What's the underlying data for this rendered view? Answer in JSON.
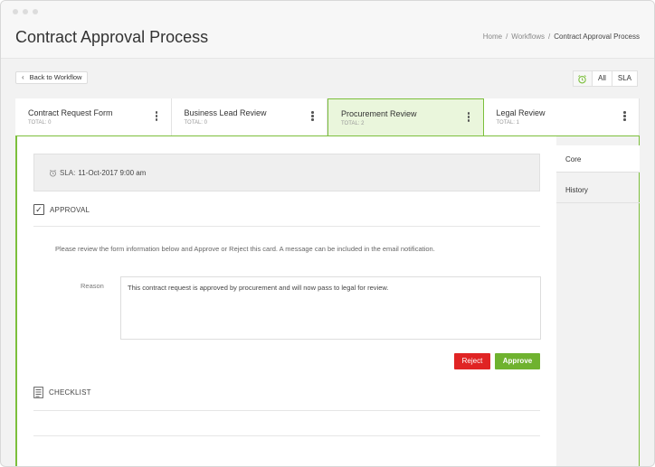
{
  "page": {
    "title": "Contract Approval Process",
    "breadcrumb": [
      "Home",
      "Workflows",
      "Contract Approval Process"
    ]
  },
  "toolbar": {
    "back_label": "Back to Workflow",
    "filter_all": "All",
    "filter_sla": "SLA"
  },
  "stages": [
    {
      "name": "Contract Request Form",
      "total": "TOTAL: 0",
      "active": false
    },
    {
      "name": "Business Lead Review",
      "total": "TOTAL: 0",
      "active": false
    },
    {
      "name": "Procurement Review",
      "total": "TOTAL: 2",
      "active": true
    },
    {
      "name": "Legal Review",
      "total": "TOTAL: 1",
      "active": false
    }
  ],
  "sla": {
    "label": "SLA:",
    "value": "11-Oct-2017 9:00 am"
  },
  "approval": {
    "heading": "APPROVAL",
    "instructions": "Please review the form information below and Approve or Reject this card. A message can be included in the email notification.",
    "reason_label": "Reason",
    "reason_value": "This contract request is approved by procurement and will now pass to legal for review.",
    "reject_label": "Reject",
    "approve_label": "Approve"
  },
  "checklist": {
    "heading": "CHECKLIST"
  },
  "side_tabs": [
    "Core",
    "History"
  ],
  "colors": {
    "accent": "#7cbf3c",
    "approve": "#6fb22f",
    "reject": "#e02424"
  }
}
